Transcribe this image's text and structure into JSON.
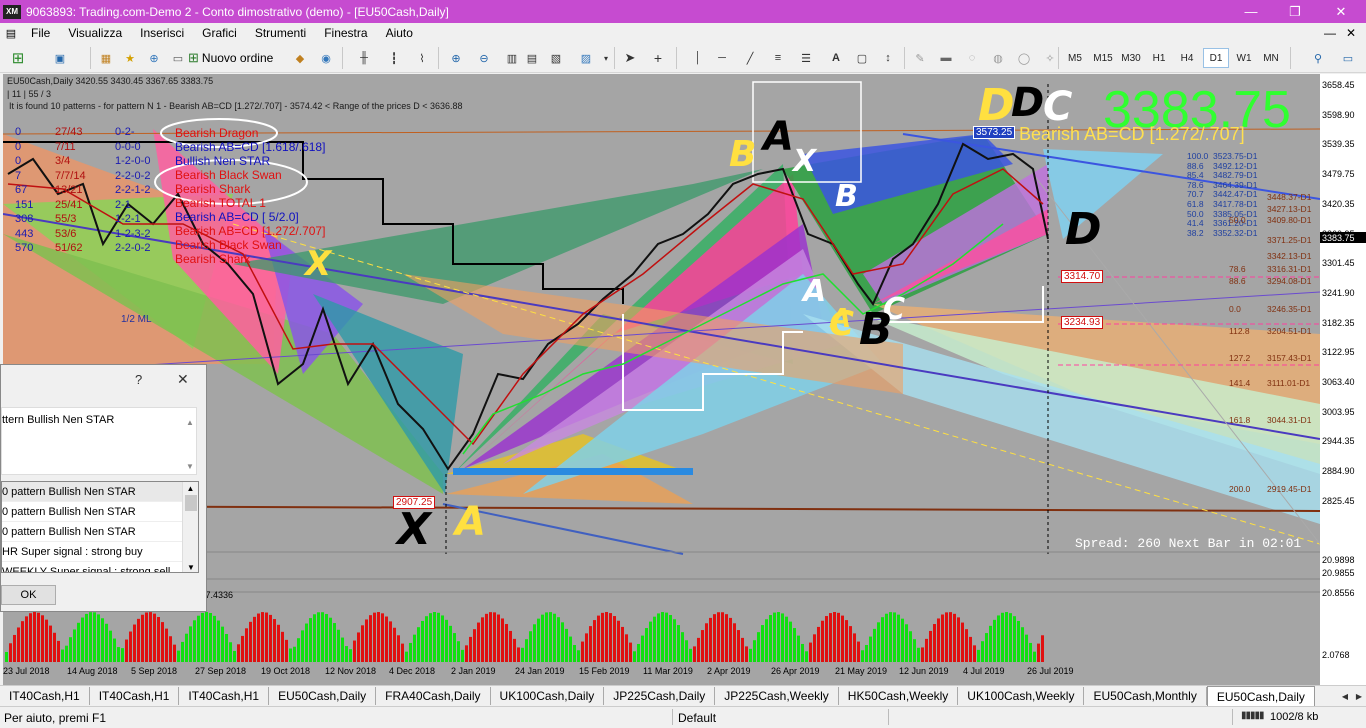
{
  "window": {
    "title": "9063893: Trading.com-Demo 2 - Conto dimostrativo (demo) - [EU50Cash,Daily]",
    "logo": "XM"
  },
  "menu": [
    "File",
    "Visualizza",
    "Inserisci",
    "Grafici",
    "Strumenti",
    "Finestra",
    "Aiuto"
  ],
  "toolbar": {
    "new_order": "Nuovo ordine",
    "timeframes": [
      "M5",
      "M15",
      "M30",
      "H1",
      "H4",
      "D1",
      "W1",
      "MN"
    ],
    "selected_timeframe": "D1"
  },
  "chart": {
    "header": "EU50Cash,Daily  3420.55 3430.45 3367.65 3383.75",
    "header2": "| 11 | 55 / 3",
    "info": "It is found 10 patterns  -  for pattern N 1 - Bearish AB=CD [1.272/.707]  -  3574.42 < Range of the prices D < 3636.88",
    "big_price": "3383.75",
    "pattern_label": "Bearish AB=CD [1.272/.707]",
    "spread": "Spread: 260 Next Bar in 02:01",
    "legend_counts": [
      {
        "a": "0",
        "b": "27/43",
        "c": "0-2-"
      },
      {
        "a": "0",
        "b": "7/11",
        "c": "0-0-0"
      },
      {
        "a": "0",
        "b": "3/4",
        "c": "1-2-0-0"
      },
      {
        "a": "7",
        "b": "7/7/14",
        "c": "2-2-0-2"
      },
      {
        "a": "67",
        "b": "13/21",
        "c": "2-2-1-2"
      },
      {
        "a": "151",
        "b": "25/41",
        "c": "2-1"
      },
      {
        "a": "308",
        "b": "55/3",
        "c": "1-2-1"
      },
      {
        "a": "443",
        "b": "53/6",
        "c": "1-2-3-2"
      },
      {
        "a": "570",
        "b": "51/62",
        "c": "2-2-0-2"
      }
    ],
    "legend_patterns": [
      "Bearish Dragon",
      "Bearish AB=CD [1.618/.618]",
      "Bullish Nen STAR",
      "Bearish Black Swan",
      "Bearish Shark",
      "Bearish TOTAL 1",
      "Bearish AB=CD [ 5/2.0]",
      "Bearish AB=CD [1.272/.707]",
      "Bearish Black Swan",
      "Bearish Shark"
    ],
    "small_label": "1/2 ML",
    "price_tags": [
      "3573.25",
      "3314.70",
      "3234.93",
      "2907.25"
    ],
    "fib_levels": [
      {
        "pct": "100.0",
        "price": "3523.75-D1"
      },
      {
        "pct": "88.6",
        "price": "3492.12-D1"
      },
      {
        "pct": "85.4",
        "price": "3482.79-D1"
      },
      {
        "pct": "78.6",
        "price": "3464.39-D1"
      },
      {
        "pct": "70.7",
        "price": "3442.47-D1"
      },
      {
        "pct": "61.8",
        "price": "3417.78-D1"
      },
      {
        "pct": "50.0",
        "price": "3385.05-D1"
      },
      {
        "pct": "41.4",
        "price": "3361.20-D1"
      },
      {
        "pct": "38.2",
        "price": "3352.32-D1"
      }
    ],
    "fib_right": [
      {
        "pct": "",
        "price": "3448.37-D1"
      },
      {
        "pct": "",
        "price": "3427.13-D1"
      },
      {
        "pct": "50.0",
        "price": "3409.80-D1"
      },
      {
        "pct": "",
        "price": "3371.25-D1"
      },
      {
        "pct": "",
        "price": "3342.13-D1"
      },
      {
        "pct": "78.6",
        "price": "3316.31-D1"
      },
      {
        "pct": "88.6",
        "price": "3294.08-D1"
      },
      {
        "pct": "0.0",
        "price": "3246.35-D1"
      },
      {
        "pct": "112.8",
        "price": "3204.51-D1"
      },
      {
        "pct": "127.2",
        "price": "3157.43-D1"
      },
      {
        "pct": "141.4",
        "price": "3111.01-D1"
      },
      {
        "pct": "161.8",
        "price": "3044.31-D1"
      },
      {
        "pct": "200.0",
        "price": "2919.45-D1"
      }
    ],
    "point_labels": [
      "X",
      "A",
      "B",
      "C",
      "D",
      "X",
      "A",
      "B",
      "C",
      "D",
      "A",
      "B",
      "C",
      "D",
      "X",
      "A"
    ],
    "x_axis": [
      "23 Jul 2018",
      "14 Aug 2018",
      "5 Sep 2018",
      "27 Sep 2018",
      "19 Oct 2018",
      "12 Nov 2018",
      "4 Dec 2018",
      "2 Jan 2019",
      "24 Jan 2019",
      "15 Feb 2019",
      "11 Mar 2019",
      "2 Apr 2019",
      "26 Apr 2019",
      "21 May 2019",
      "12 Jun 2019",
      "4 Jul 2019",
      "26 Jul 2019"
    ],
    "y_axis": [
      "3658.45",
      "3598.90",
      "3539.35",
      "3479.75",
      "3420.35",
      "3360.95",
      "3301.45",
      "3241.90",
      "3182.35",
      "3122.95",
      "3063.40",
      "3003.95",
      "2944.35",
      "2884.90",
      "2825.45"
    ],
    "y_current": "3383.75",
    "osc1_y": [
      "20.9898",
      "20.9855"
    ],
    "osc2_y": [
      "20.8556",
      "2.0768"
    ],
    "osc_label": "3 7.4336"
  },
  "dialog": {
    "help": "?",
    "close": "✕",
    "message": "ttern Bullish Nen STAR",
    "list": [
      "0 pattern Bullish Nen STAR",
      "0 pattern Bullish Nen STAR",
      "0 pattern Bullish Nen STAR",
      "HR Super signal : strong buy",
      "WEEKLY Super signal : strong sell"
    ],
    "ok": "OK"
  },
  "tabs": [
    "IT40Cash,H1",
    "IT40Cash,H1",
    "IT40Cash,H1",
    "EU50Cash,Daily",
    "FRA40Cash,Daily",
    "UK100Cash,Daily",
    "JP225Cash,Daily",
    "JP225Cash,Weekly",
    "HK50Cash,Weekly",
    "UK100Cash,Weekly",
    "EU50Cash,Monthly",
    "EU50Cash,Daily"
  ],
  "selected_tab": 11,
  "status": {
    "help": "Per aiuto, premi F1",
    "profile": "Default",
    "traffic": "1002/8 kb"
  }
}
